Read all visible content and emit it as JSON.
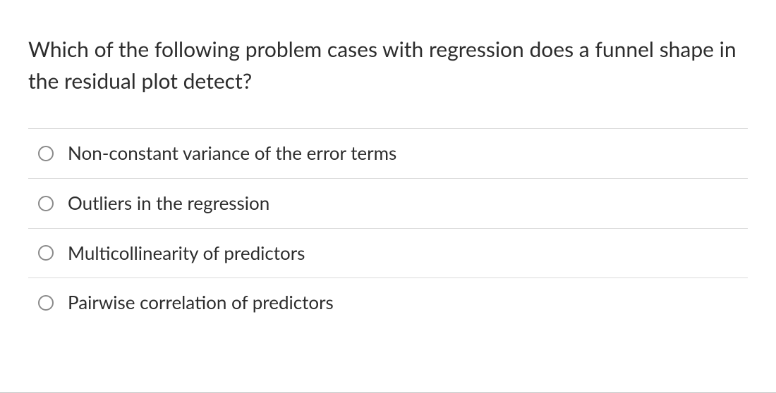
{
  "question": {
    "text": "Which of the following problem cases with regression does a funnel shape in the residual plot detect?"
  },
  "options": [
    {
      "label": "Non-constant variance of the error terms"
    },
    {
      "label": "Outliers in the regression"
    },
    {
      "label": "Multicollinearity of predictors"
    },
    {
      "label": "Pairwise correlation of predictors"
    }
  ]
}
